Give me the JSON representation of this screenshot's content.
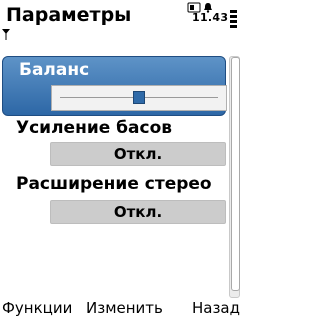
{
  "header": {
    "title": "Параметры",
    "time": "11.43"
  },
  "icons": {
    "antenna": "antenna-icon",
    "signal": "signal-strength-icon",
    "battery": "battery-icon",
    "sim": "sim-card-icon",
    "bell": "bell-icon"
  },
  "settings": {
    "balance": {
      "label": "Баланс",
      "slider_fraction": 0.5
    },
    "bass": {
      "label": "Усиление басов",
      "value": "Откл."
    },
    "stereo": {
      "label": "Расширение стерео",
      "value": "Откл."
    }
  },
  "softkeys": {
    "left": "Функции",
    "middle": "Изменить",
    "right": "Назад"
  },
  "colors": {
    "selection": "#2d67a6",
    "value_box": "#cccccc",
    "slider_thumb": "#2f6aa8"
  }
}
